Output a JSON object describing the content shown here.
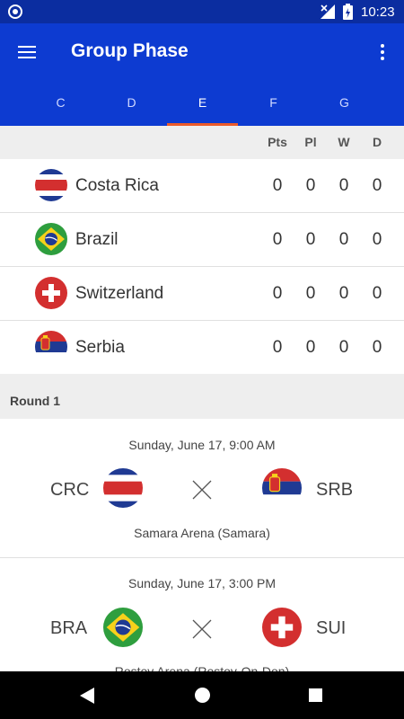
{
  "status_bar": {
    "time": "10:23"
  },
  "app_bar": {
    "title": "Group Phase"
  },
  "tabs": [
    {
      "label": "C"
    },
    {
      "label": "D"
    },
    {
      "label": "E",
      "active": true
    },
    {
      "label": "F"
    },
    {
      "label": "G"
    }
  ],
  "table": {
    "columns": [
      "Pts",
      "Pl",
      "W",
      "D"
    ],
    "rows": [
      {
        "flag": "costa-rica-flag-icon",
        "name": "Costa Rica",
        "pts": "0",
        "pl": "0",
        "w": "0",
        "d": "0"
      },
      {
        "flag": "brazil-flag-icon",
        "name": "Brazil",
        "pts": "0",
        "pl": "0",
        "w": "0",
        "d": "0"
      },
      {
        "flag": "switzerland-flag-icon",
        "name": "Switzerland",
        "pts": "0",
        "pl": "0",
        "w": "0",
        "d": "0"
      },
      {
        "flag": "serbia-flag-icon",
        "name": "Serbia",
        "pts": "0",
        "pl": "0",
        "w": "0",
        "d": "0"
      }
    ]
  },
  "round": {
    "label": "Round 1"
  },
  "matches": [
    {
      "date": "Sunday, June 17, 9:00 AM",
      "home": "CRC",
      "away": "SRB",
      "venue": "Samara Arena (Samara)"
    },
    {
      "date": "Sunday, June 17, 3:00 PM",
      "home": "BRA",
      "away": "SUI",
      "venue": "Rostov Arena (Rostov-On-Don)"
    }
  ],
  "colors": {
    "primary": "#0d3bd1",
    "status_bar": "#0b2da0",
    "tab_indicator": "#ea5a2a"
  }
}
